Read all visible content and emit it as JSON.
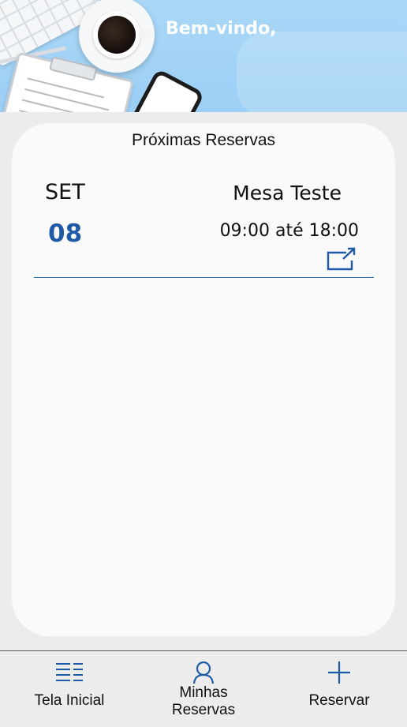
{
  "header": {
    "welcome_text": "Bem-vindo,"
  },
  "upcoming": {
    "title": "Próximas Reservas",
    "reservations": [
      {
        "month": "SET",
        "day": "08",
        "desk": "Mesa Teste",
        "time": "09:00 até 18:00",
        "action_icon": "open-external-icon"
      }
    ]
  },
  "nav": {
    "items": [
      {
        "label": "Tela Inicial",
        "icon": "list-icon"
      },
      {
        "label_line1": "Minhas",
        "label_line2": "Reservas",
        "icon": "user-icon"
      },
      {
        "label": "Reservar",
        "icon": "plus-icon"
      }
    ]
  },
  "colors": {
    "accent": "#1f5aa8",
    "header_bg": "#a9d7f7",
    "background": "#ececec",
    "card": "#fafafa"
  }
}
